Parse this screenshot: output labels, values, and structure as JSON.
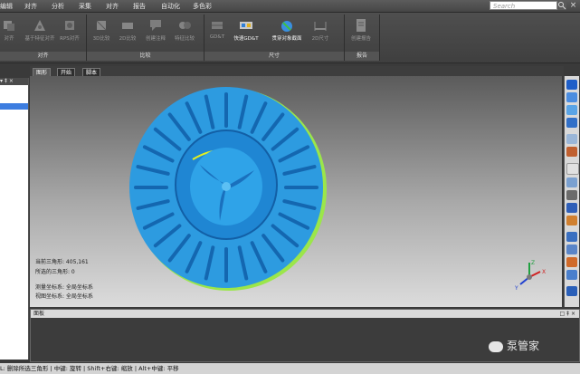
{
  "menu": [
    "编辑",
    "对齐",
    "分析",
    "采集",
    "对齐",
    "报告",
    "自动化",
    "多色彩"
  ],
  "search": {
    "placeholder": "Search"
  },
  "window": {
    "close_glyph": "×"
  },
  "ribbon": {
    "groups": [
      {
        "label": "对齐",
        "buttons": [
          {
            "label": "对齐",
            "icon": "align-icon"
          },
          {
            "label": "基于特征对齐",
            "icon": "feature-align-icon"
          },
          {
            "label": "RPS对齐",
            "icon": "rps-align-icon"
          }
        ]
      },
      {
        "label": "比较",
        "buttons": [
          {
            "label": "3D比较",
            "icon": "compare-3d-icon"
          },
          {
            "label": "2D比较",
            "icon": "compare-2d-icon"
          },
          {
            "label": "创建注释",
            "icon": "annotation-icon"
          },
          {
            "label": "特征比较",
            "icon": "feature-compare-icon"
          }
        ]
      },
      {
        "label": "尺寸",
        "buttons": [
          {
            "label": "GD&T",
            "icon": "gdt-icon"
          },
          {
            "label": "快速GD&T",
            "icon": "quick-gdt-icon"
          },
          {
            "label": "贯穿对象截面",
            "icon": "section-icon"
          },
          {
            "label": "2D尺寸",
            "icon": "dimension-2d-icon"
          }
        ]
      },
      {
        "label": "报告",
        "buttons": [
          {
            "label": "创建报告",
            "icon": "report-icon"
          }
        ]
      }
    ]
  },
  "tabs": [
    "图形",
    "开始",
    "脚本"
  ],
  "panel_glyphs": {
    "pin": "▾ ‡ ×"
  },
  "viewport": {
    "info": [
      "当前三角形: 405,161",
      "所选的三角形: 0",
      "测量坐标系: 全局坐标系",
      "视图坐标系: 全局坐标系"
    ],
    "axes": {
      "x": "X",
      "y": "Y",
      "z": "Z"
    }
  },
  "bottom_panel": {
    "title": "面板",
    "controls": "□ ‡ ×"
  },
  "status_bar": "L: 删除所选三角形 | 中键: 旋转 | Shift+右键: 缩放 | Alt+中键: 平移",
  "watermark": "泵管家",
  "colors": {
    "part": "#2d9be0",
    "part_dark": "#1467b0",
    "highlight": "#e6f020"
  }
}
